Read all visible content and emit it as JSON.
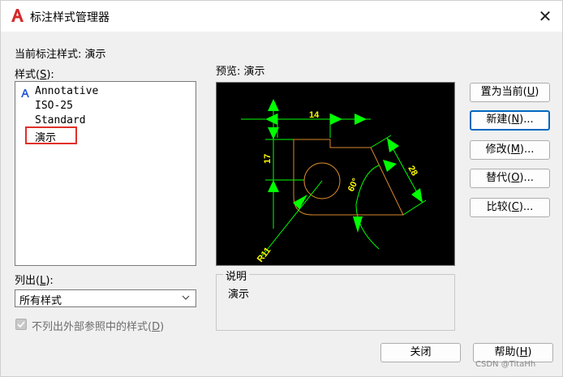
{
  "window": {
    "title": "标注样式管理器",
    "close_symbol": "✕"
  },
  "current_style": {
    "label": "当前标注样式:",
    "value": "演示"
  },
  "styles_section": {
    "label_pre": "样式(",
    "label_key": "S",
    "label_post": "):"
  },
  "style_list": {
    "items": [
      "Annotative",
      "ISO-25",
      "Standard",
      "演示"
    ],
    "selected": "演示"
  },
  "preview_section": {
    "label": "预览:",
    "value": "演示"
  },
  "list_section": {
    "label_pre": "列出(",
    "label_key": "L",
    "label_post": "):",
    "selected_value": "所有样式"
  },
  "exclude_xref": {
    "label_pre": "不列出外部参照中的样式(",
    "label_key": "D",
    "label_post": ")",
    "checked": true
  },
  "description": {
    "title": "说明",
    "text": "演示"
  },
  "buttons": {
    "set_current": {
      "pre": "置为当前(",
      "key": "U",
      "post": ")"
    },
    "new": {
      "pre": "新建(",
      "key": "N",
      "post": ")..."
    },
    "modify": {
      "pre": "修改(",
      "key": "M",
      "post": ")..."
    },
    "override": {
      "pre": "替代(",
      "key": "O",
      "post": ")..."
    },
    "compare": {
      "pre": "比较(",
      "key": "C",
      "post": ")..."
    },
    "close": {
      "label": "关闭"
    },
    "help": {
      "pre": "帮助(",
      "key": "H",
      "post": ")"
    }
  },
  "preview_drawing": {
    "dim_horizontal": "14",
    "dim_vertical": "17",
    "dim_aligned": "28",
    "dim_angle": "60°",
    "dim_radius": "R11"
  },
  "colors": {
    "accent": "#0067c0",
    "highlight_box": "#e0302a",
    "dim_line": "#00ff00",
    "dim_text": "#ffff00",
    "geometry": "#d98a2c",
    "app_icon": "#d42b2b"
  },
  "watermark": "CSDN @TitaHh"
}
